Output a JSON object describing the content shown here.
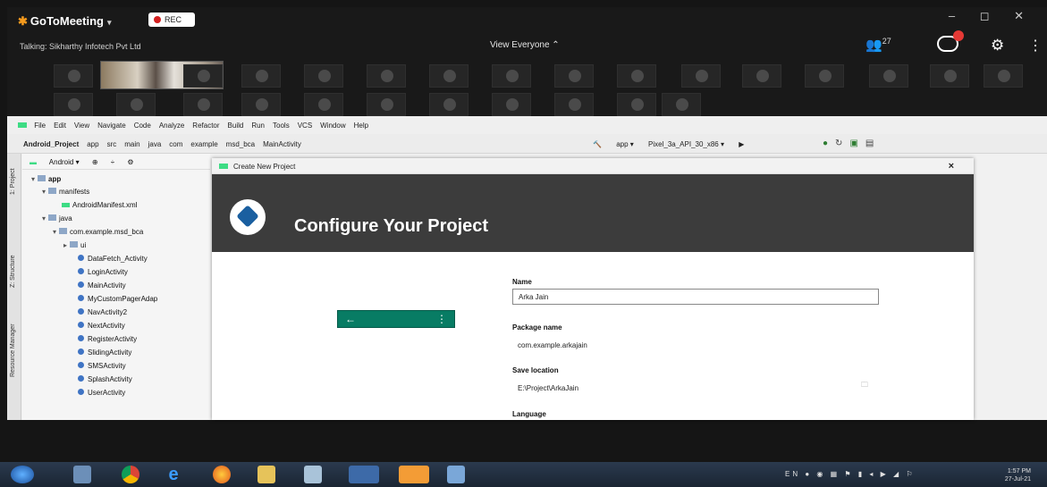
{
  "gotomeeting": {
    "app_name": "GoToMeeting",
    "caret": "▾",
    "rec_label": "REC",
    "talking": "Talking: Sikharthy Infotech Pvt Ltd",
    "view_selector": "View Everyone ⌃",
    "attendee_count": "27",
    "window_controls": "– ◻ ✕",
    "gear_icon": "gear-icon",
    "more_icon": "more-vert-icon"
  },
  "android_studio": {
    "menu": [
      "File",
      "Edit",
      "View",
      "Navigate",
      "Code",
      "Analyze",
      "Refactor",
      "Build",
      "Run",
      "Tools",
      "VCS",
      "Window",
      "Help"
    ],
    "breadcrumb": [
      "Android_Project",
      "app",
      "src",
      "main",
      "java",
      "com",
      "example",
      "msd_bca",
      "MainActivity"
    ],
    "run_config": "app ▾",
    "device": "Pixel_3a_API_30_x86 ▾",
    "project_view": "Android ▾",
    "side_tabs": {
      "project": "1: Project",
      "structure": "Z: Structure",
      "resource": "Resource Manager"
    },
    "tree": {
      "app": "app",
      "manifests": "manifests",
      "manifest_file": "AndroidManifest.xml",
      "java": "java",
      "package": "com.example.msd_bca",
      "ui": "ui",
      "classes": [
        "DataFetch_Activity",
        "LoginActivity",
        "MainActivity",
        "MyCustomPagerAdap",
        "NavActivity2",
        "NextActivity",
        "RegisterActivity",
        "SlidingActivity",
        "SMSActivity",
        "SplashActivity",
        "UserActivity"
      ]
    }
  },
  "dialog": {
    "title": "Create New Project",
    "close": "×",
    "heading": "Configure Your Project",
    "name_label": "Name",
    "name_value": "Arka Jain",
    "package_label": "Package name",
    "package_value": "com.example.arkajain",
    "save_label": "Save location",
    "save_value": "E:\\Project\\ArkaJain",
    "language_label": "Language",
    "preview_back": "←",
    "preview_more": "⋮"
  },
  "taskbar": {
    "lang": "EN",
    "time": "1:57 PM",
    "date": "27-Jul-21"
  },
  "colors": {
    "android_green": "#3ddc84",
    "banner": "#3c3c3c",
    "preview_teal": "#087c64",
    "rec_red": "#d32020"
  }
}
